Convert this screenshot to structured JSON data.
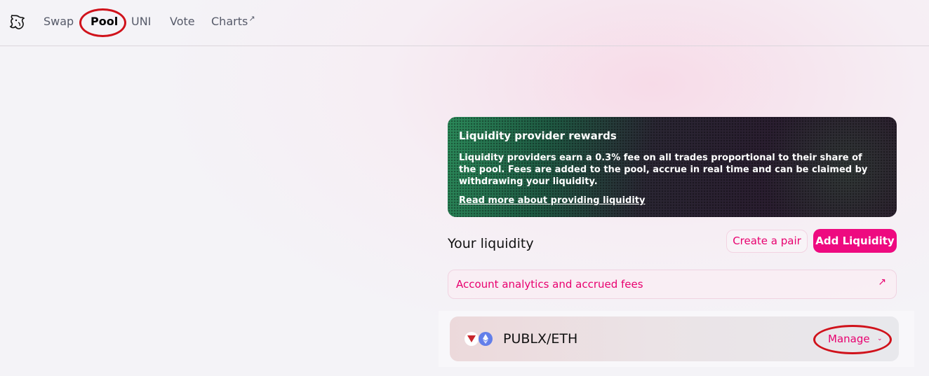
{
  "nav": {
    "logo": "uniswap-unicorn-icon",
    "items": [
      {
        "label": "Swap",
        "active": false
      },
      {
        "label": "Pool",
        "active": true
      },
      {
        "label": "UNI",
        "active": false
      },
      {
        "label": "Vote",
        "active": false
      },
      {
        "label": "Charts",
        "external_icon": "↗",
        "active": false
      }
    ]
  },
  "rewards": {
    "title": "Liquidity provider rewards",
    "body": "Liquidity providers earn a 0.3% fee on all trades proportional to their share of the pool. Fees are added to the pool, accrue in real time and can be claimed by withdrawing your liquidity.",
    "link": "Read more about providing liquidity"
  },
  "liquidity": {
    "heading": "Your liquidity",
    "create_pair": "Create a pair",
    "add_liquidity": "Add Liquidity",
    "analytics_link": "Account analytics and accrued fees",
    "analytics_arrow": "↗"
  },
  "position": {
    "pair": "PUBLX/ETH",
    "manage": "Manage",
    "chevron": "⌄"
  },
  "colors": {
    "accent": "#e8006f",
    "primary_button": "#ee0a80",
    "annotation": "#d0121b"
  }
}
